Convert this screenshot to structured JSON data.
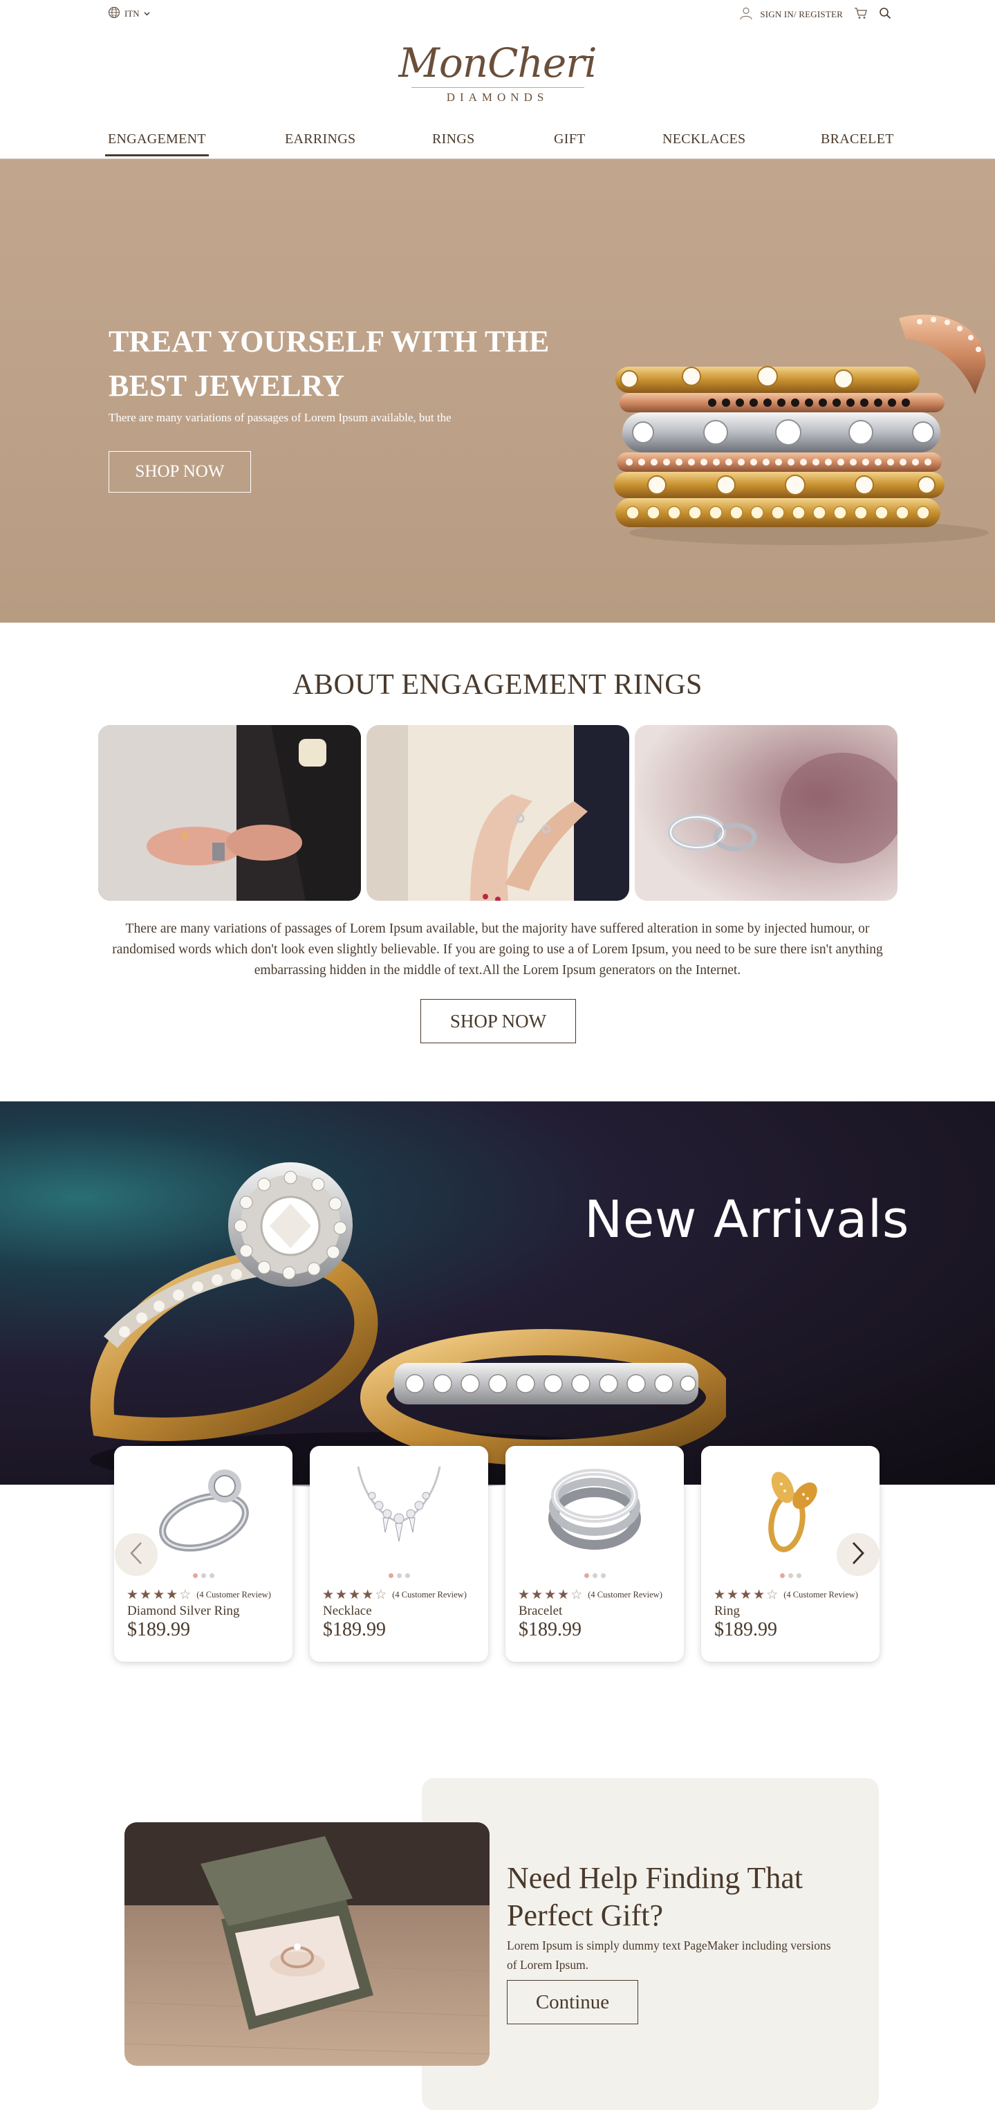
{
  "topbar": {
    "language": "ITN",
    "signin_label": "SIGN IN/ REGISTER",
    "icons": [
      "globe-icon",
      "chevron-down-icon",
      "user-icon",
      "cart-icon",
      "search-icon"
    ]
  },
  "logo": {
    "script": "MonCheri",
    "subtitle": "DIAMONDS"
  },
  "nav": {
    "items": [
      {
        "label": "ENGAGEMENT",
        "active": true
      },
      {
        "label": "EARRINGS",
        "active": false
      },
      {
        "label": "RINGS",
        "active": false
      },
      {
        "label": "GIFT",
        "active": false
      },
      {
        "label": "NECKLACES",
        "active": false
      },
      {
        "label": "BRACELET",
        "active": false
      }
    ]
  },
  "hero": {
    "title": "TREAT YOURSELF WITH THE BEST JEWELRY",
    "subtitle": "There are many variations of passages of Lorem Ipsum available, but the",
    "button_label": "SHOP NOW"
  },
  "about": {
    "title": "ABOUT ENGAGEMENT RINGS",
    "text": "There are many variations of passages of Lorem Ipsum available, but the majority have suffered alteration in some by injected humour, or randomised words which don't look even slightly believable. If you are going to use a of Lorem Ipsum, you need to be sure there isn't anything embarrassing hidden in the middle of text.All the Lorem Ipsum generators on the Internet.",
    "button_label": "SHOP NOW"
  },
  "arrivals": {
    "title": "New Arrivals",
    "products": [
      {
        "name": "Diamond Silver Ring",
        "price": "$189.99",
        "rating": 4,
        "review_text": "(4 Customer Review)",
        "image": "silver-ring"
      },
      {
        "name": "Necklace",
        "price": "$189.99",
        "rating": 4,
        "review_text": "(4 Customer Review)",
        "image": "necklace"
      },
      {
        "name": "Bracelet",
        "price": "$189.99",
        "rating": 4,
        "review_text": "(4 Customer Review)",
        "image": "bracelet"
      },
      {
        "name": "Ring",
        "price": "$189.99",
        "rating": 4,
        "review_text": "(4 Customer Review)",
        "image": "gold-ring"
      }
    ]
  },
  "gift": {
    "title": "Need Help Finding That Perfect Gift?",
    "text": "Lorem Ipsum is simply dummy text PageMaker including versions of Lorem Ipsum.",
    "button_label": "Continue"
  },
  "colors": {
    "text_brown": "#4a3a2c",
    "hero_bg": "#bea38a",
    "gift_panel": "#f3f1ec",
    "star": "#7a5a4a"
  }
}
